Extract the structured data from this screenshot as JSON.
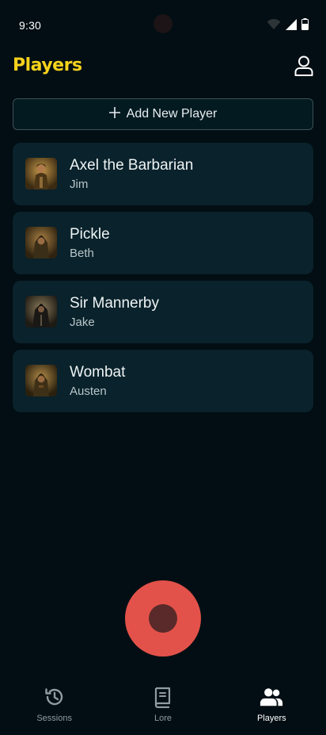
{
  "status_bar": {
    "time": "9:30",
    "icons": [
      "wifi-icon",
      "signal-icon",
      "battery-icon"
    ]
  },
  "header": {
    "title": "Players",
    "profile_icon": "user-icon"
  },
  "add_button": {
    "label": "Add New Player",
    "icon": "plus-icon"
  },
  "players": [
    {
      "name": "Axel the Barbarian",
      "owner": "Jim",
      "avatar": "barbarian-portrait"
    },
    {
      "name": "Pickle",
      "owner": "Beth",
      "avatar": "hooded-ranger-portrait"
    },
    {
      "name": "Sir Mannerby",
      "owner": "Jake",
      "avatar": "dark-knight-portrait"
    },
    {
      "name": "Wombat",
      "owner": "Austen",
      "avatar": "hooded-rogue-portrait"
    }
  ],
  "record_button": {
    "icon": "record-icon"
  },
  "nav": {
    "items": [
      {
        "label": "Sessions",
        "icon": "history-icon",
        "active": false
      },
      {
        "label": "Lore",
        "icon": "book-icon",
        "active": false
      },
      {
        "label": "Players",
        "icon": "people-icon",
        "active": true
      }
    ]
  },
  "colors": {
    "background": "#020e13",
    "title_accent": "#f5d21c",
    "card": "#0a222b",
    "record": "#e3524a"
  }
}
